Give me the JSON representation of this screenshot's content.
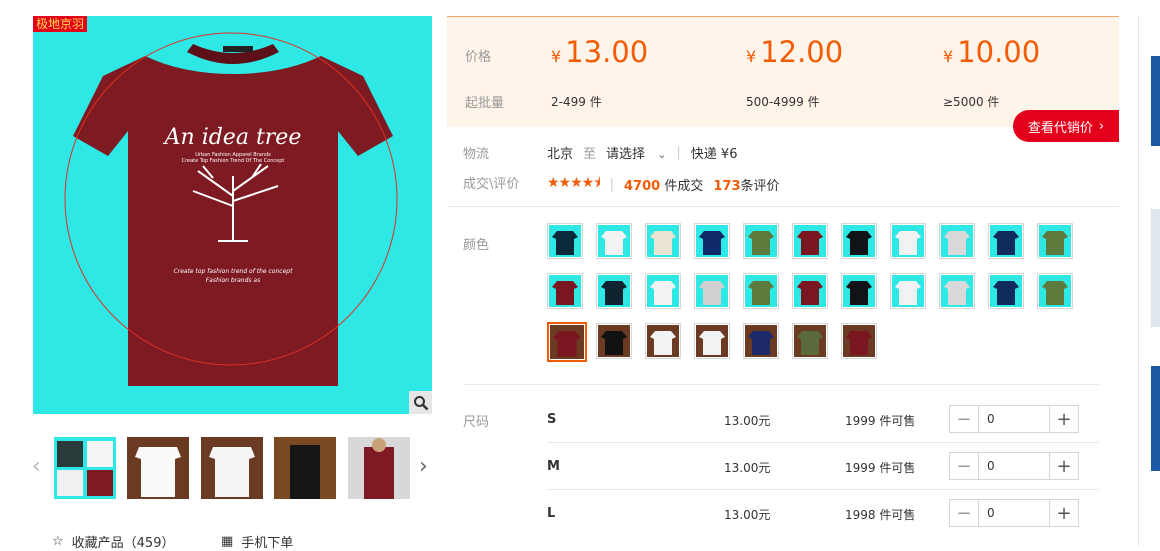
{
  "brand_tag": "极地京羽",
  "shirt": {
    "headline": "An idea tree",
    "sub": "Urban Fashion Apparel Brands",
    "sub2": "Create Top Fashion Trend Of The Concept",
    "script1": "Create top fashion trend of the concept",
    "script2": "Fashion brands as"
  },
  "actions": {
    "favorite": "收藏产品（459）",
    "mobile_order": "手机下单"
  },
  "price_label": "价格",
  "moq_label": "起批量",
  "tiers": [
    {
      "currency": "¥",
      "price": "13.00",
      "range": "2-499",
      "unit": "件"
    },
    {
      "currency": "¥",
      "price": "12.00",
      "range": "500-4999",
      "unit": "件"
    },
    {
      "currency": "¥",
      "price": "10.00",
      "range": "≥5000",
      "unit": "件"
    }
  ],
  "agent_button": "查看代销价",
  "logistics": {
    "label": "物流",
    "origin": "北京",
    "to": "至",
    "dest": "请选择",
    "shipping": "快递 ¥6"
  },
  "deals": {
    "label": "成交\\评价",
    "rating": 4.5,
    "sold_count": "4700",
    "sold_text": "件成交",
    "review_count": "173",
    "review_text": "条评价"
  },
  "color_label": "颜色",
  "size_label": "尺码",
  "swatches": [
    [
      "#0a2a3a",
      "#f2f2f2",
      "#e9e3d2",
      "#0e2a6a",
      "#5b7a3c",
      "#7a1620",
      "#101418",
      "#f2f2f2",
      "#d9d9d9",
      "#0f2a5c",
      "#5b7a3c"
    ],
    [
      "#7a1620",
      "#0e2430",
      "#f2f2f2",
      "#d0d0d0",
      "#5b7a3c",
      "#7a1620",
      "#101418",
      "#f2f2f2",
      "#d9d9d9",
      "#0f2a5c",
      "#5b7a3c"
    ],
    [
      "#7a1620",
      "#121212",
      "#f2f2f2",
      "#f2f2f2",
      "#1c2a6a",
      "#5b6a3c",
      "#7a1620"
    ]
  ],
  "sizes": [
    {
      "name": "S",
      "price": "13.00元",
      "stock": "1999 件可售",
      "qty": "0"
    },
    {
      "name": "M",
      "price": "13.00元",
      "stock": "1999 件可售",
      "qty": "0"
    },
    {
      "name": "L",
      "price": "13.00元",
      "stock": "1998 件可售",
      "qty": "0"
    }
  ]
}
